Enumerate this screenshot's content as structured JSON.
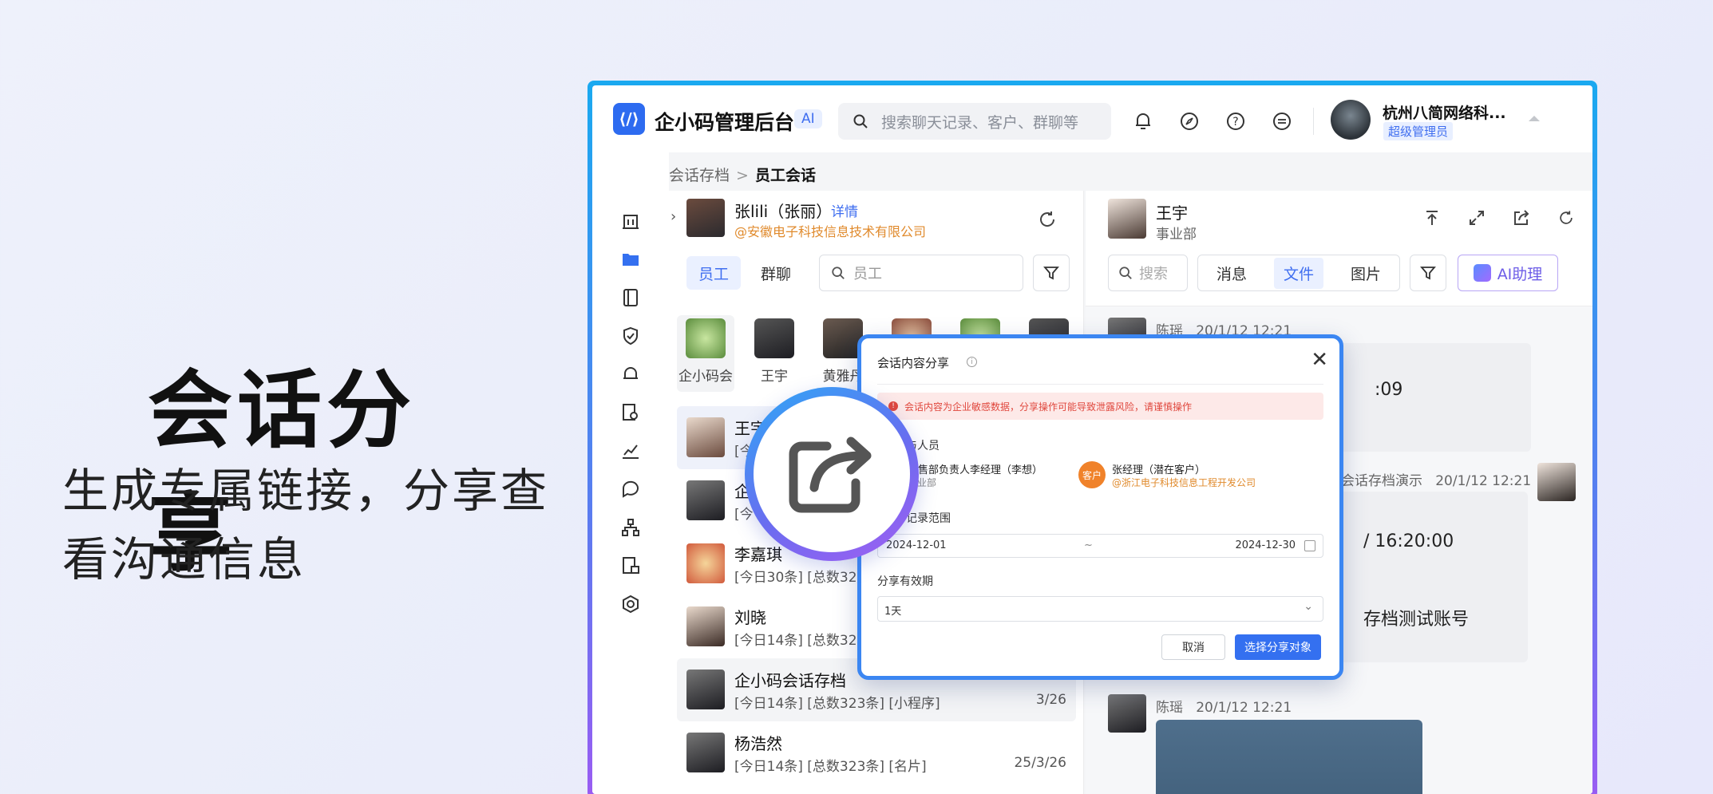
{
  "hero": {
    "title": "会话分享",
    "subtitle_line1": "生成专属链接，分享查",
    "subtitle_line2": "看沟通信息"
  },
  "topbar": {
    "app_title": "企小码管理后台",
    "ai_badge": "AI",
    "search_placeholder": "搜索聊天记录、客户、群聊等",
    "org_name": "杭州八简网络科...",
    "org_role": "超级管理员"
  },
  "breadcrumb": {
    "parent": "会话存档",
    "separator": ">",
    "current": "员工会话"
  },
  "left_panel": {
    "person_name": "张lili（张丽）",
    "detail_link": "详情",
    "company": "@安徽电子科技信息技术有限公司",
    "tabs": [
      "员工",
      "群聊"
    ],
    "search_placeholder": "员工",
    "avatar_strip": [
      "企小码会",
      "王宇",
      "黄雅丹"
    ],
    "chats": [
      {
        "name": "王宇",
        "meta": "[今",
        "date": ""
      },
      {
        "name": "企",
        "meta": "[今",
        "date": ""
      },
      {
        "name": "李嘉琪",
        "meta": "[今日30条] [总数322",
        "date": ""
      },
      {
        "name": "刘晓",
        "meta": "[今日14条] [总数323",
        "date": ""
      },
      {
        "name": "企小码会话存档",
        "meta": "[今日14条] [总数323条] [小程序]",
        "date": "3/26"
      },
      {
        "name": "杨浩然",
        "meta": "[今日14条] [总数323条] [名片]",
        "date": "25/3/26"
      }
    ]
  },
  "right_panel": {
    "name": "王宇",
    "dept": "事业部",
    "search_placeholder": "搜索",
    "tabs": [
      "消息",
      "文件",
      "图片"
    ],
    "active_tab": "文件",
    "ai_helper": "AI助理",
    "messages": [
      {
        "sender": "陈瑶",
        "time": "20/1/12 12:21",
        "text": ":09"
      },
      {
        "sender": "会话存档演示",
        "time": "20/1/12 12:21",
        "text1": "/ 16:20:00",
        "text2": "存档测试账号"
      },
      {
        "sender": "陈瑶",
        "time": "20/1/12 12:21"
      }
    ]
  },
  "modal": {
    "title": "会话内容分享",
    "info_icon": "i",
    "warning": "会话内容为企业敏感数据，分享操作可能导致泄露风险，请谨慎操作",
    "participants_label": "与人员",
    "person_a_name": "销售部负责人李经理（李想）",
    "person_a_dept": "事业部",
    "customer_badge": "客户",
    "person_b_name": "张经理（潜在客户）",
    "person_b_company": "@浙江电子科技信息工程开发公司",
    "range_label": "记录范围",
    "start_date": "2024-12-01",
    "range_sep": "~",
    "end_date": "2024-12-30",
    "validity_label": "分享有效期",
    "validity_value": "1天",
    "cancel": "取消",
    "select_target": "选择分享对象"
  },
  "colors": {
    "accent": "#3470f0",
    "warning": "#e0473d",
    "orange": "#f0822a"
  }
}
